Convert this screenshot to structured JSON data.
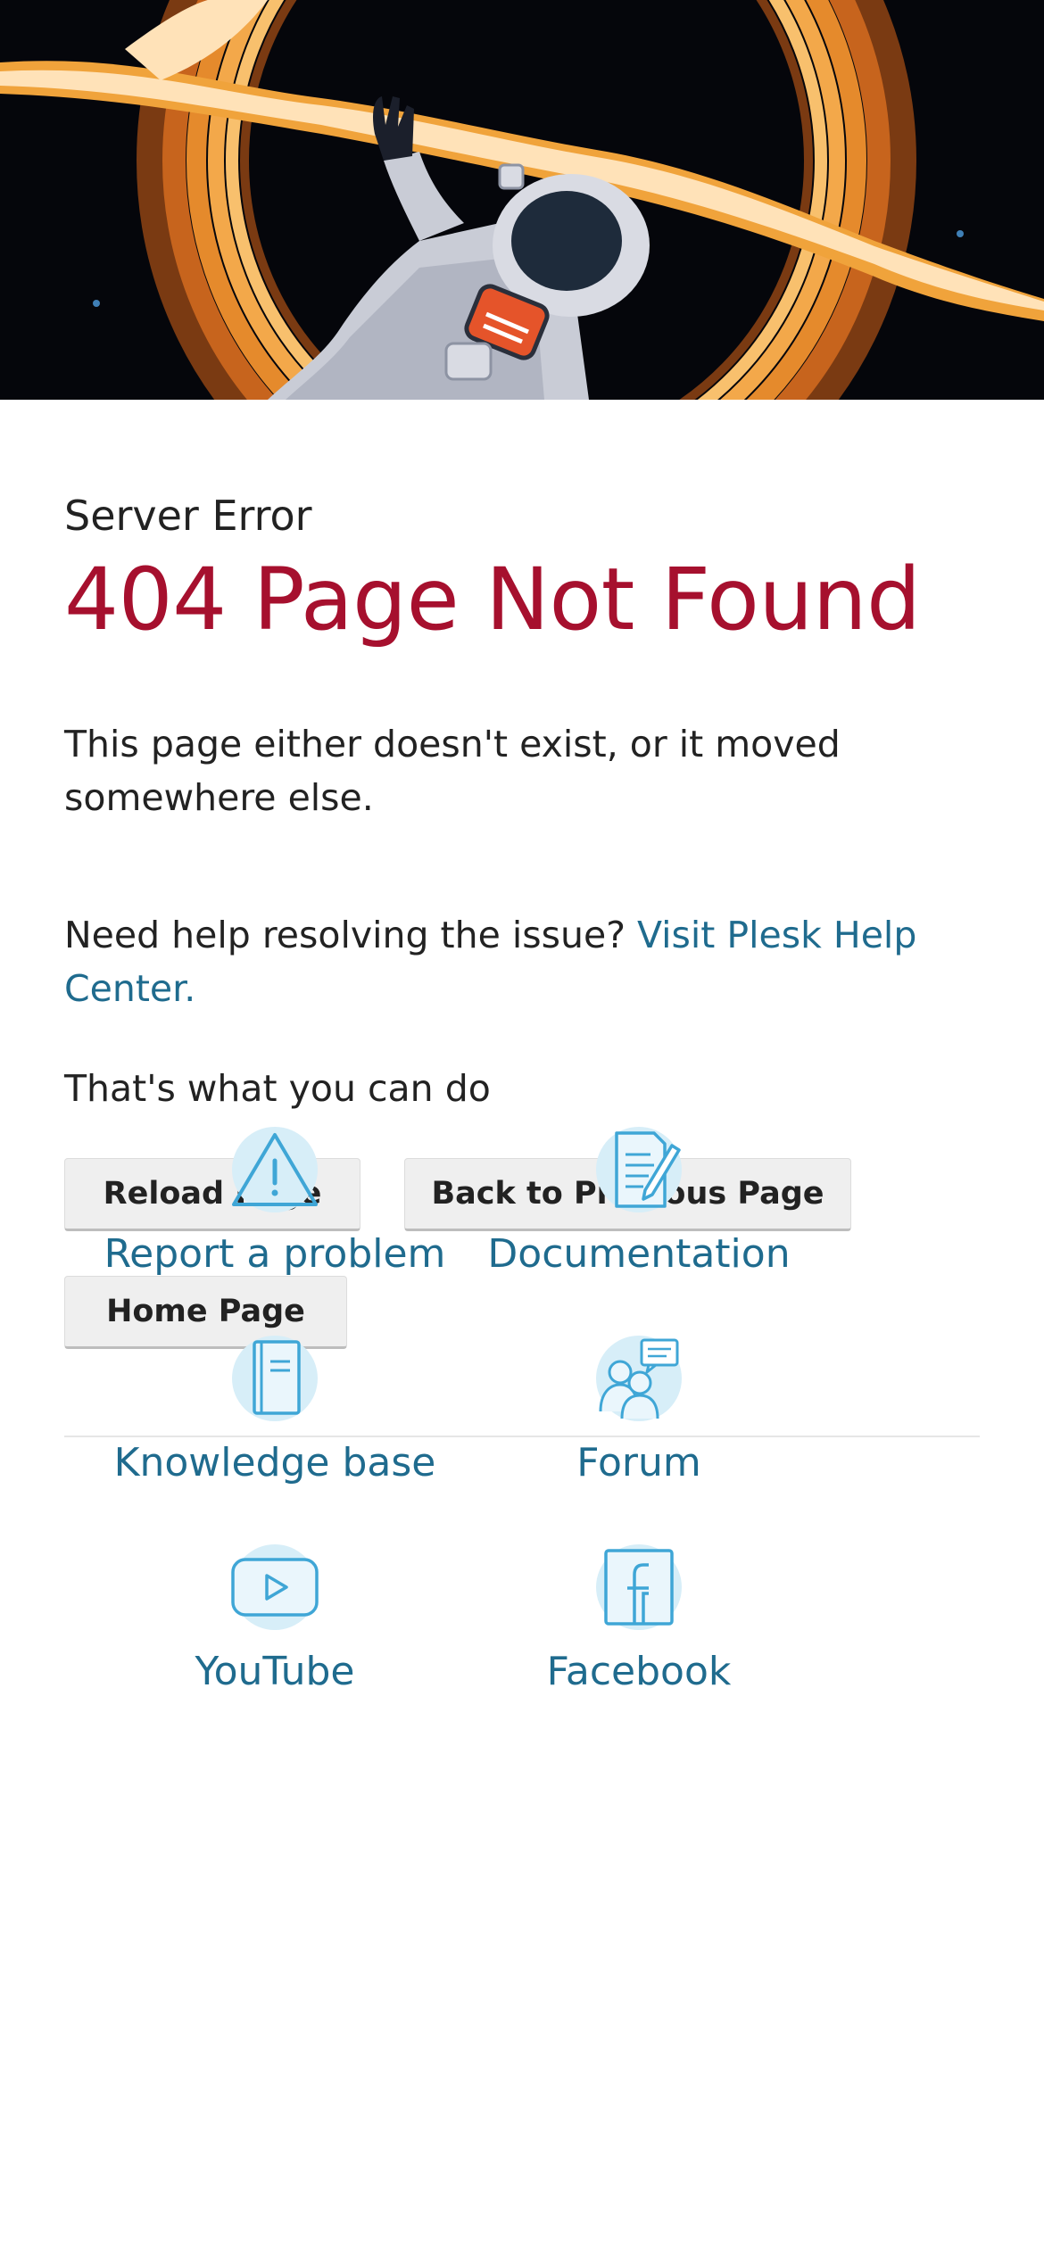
{
  "hero": {
    "image": "astronaut-black-hole-illustration"
  },
  "error": {
    "eyebrow": "Server Error",
    "title": "404 Page Not Found",
    "description": "This page either doesn't exist, or it moved somewhere else."
  },
  "help": {
    "prefix": "Need help resolving the issue? ",
    "link_text": "Visit Plesk Help Center."
  },
  "actions": {
    "heading": "That's what you can do",
    "reload": "Reload Page",
    "back": "Back to Previous Page",
    "home": "Home Page"
  },
  "resources": [
    {
      "label": "Report a problem",
      "icon": "warning-icon"
    },
    {
      "label": "Documentation",
      "icon": "document-pencil-icon"
    },
    {
      "label": "Knowledge base",
      "icon": "book-icon"
    },
    {
      "label": "Forum",
      "icon": "forum-people-icon"
    },
    {
      "label": "YouTube",
      "icon": "youtube-icon"
    },
    {
      "label": "Facebook",
      "icon": "facebook-icon"
    }
  ],
  "colors": {
    "title_red": "#a6102e",
    "link_blue": "#1f6b8e",
    "icon_bg": "#d7eef8",
    "icon_stroke": "#3fa6d6"
  }
}
